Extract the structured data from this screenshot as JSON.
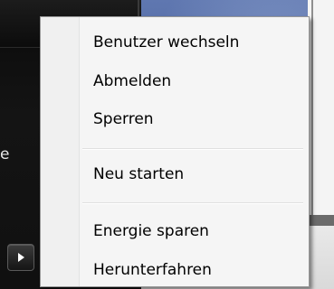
{
  "background": {
    "left_edge_text": "e"
  },
  "menu": {
    "items": [
      {
        "label": "Benutzer wechseln"
      },
      {
        "label": "Abmelden"
      },
      {
        "label": "Sperren"
      },
      {
        "label": "Neu starten"
      },
      {
        "label": "Energie sparen"
      },
      {
        "label": "Herunterfahren"
      }
    ]
  },
  "icons": {
    "arrow_button": "play-arrow-icon"
  },
  "colors": {
    "menu_background": "#f5f5f5",
    "menu_border": "#979797",
    "text": "#000000"
  }
}
